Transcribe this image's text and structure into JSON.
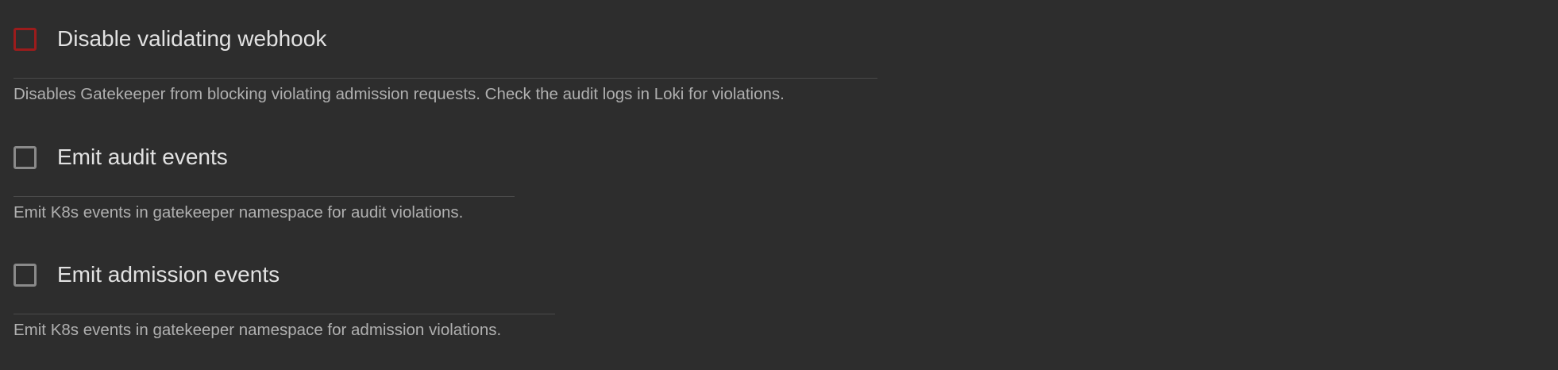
{
  "settings": [
    {
      "title": "Disable validating webhook",
      "description": "Disables Gatekeeper from blocking violating admission requests. Check the audit logs in Loki for violations.",
      "checked": false,
      "focused": true
    },
    {
      "title": "Emit audit events",
      "description": "Emit K8s events in gatekeeper namespace for audit violations.",
      "checked": false,
      "focused": false
    },
    {
      "title": "Emit admission events",
      "description": "Emit K8s events in gatekeeper namespace for admission violations.",
      "checked": false,
      "focused": false
    }
  ],
  "colors": {
    "background": "#2d2d2d",
    "focus_border": "#9b1c1c",
    "checkbox_border": "#8a8a8a",
    "title_text": "#e2e2e2",
    "description_text": "#b0b0b0"
  }
}
